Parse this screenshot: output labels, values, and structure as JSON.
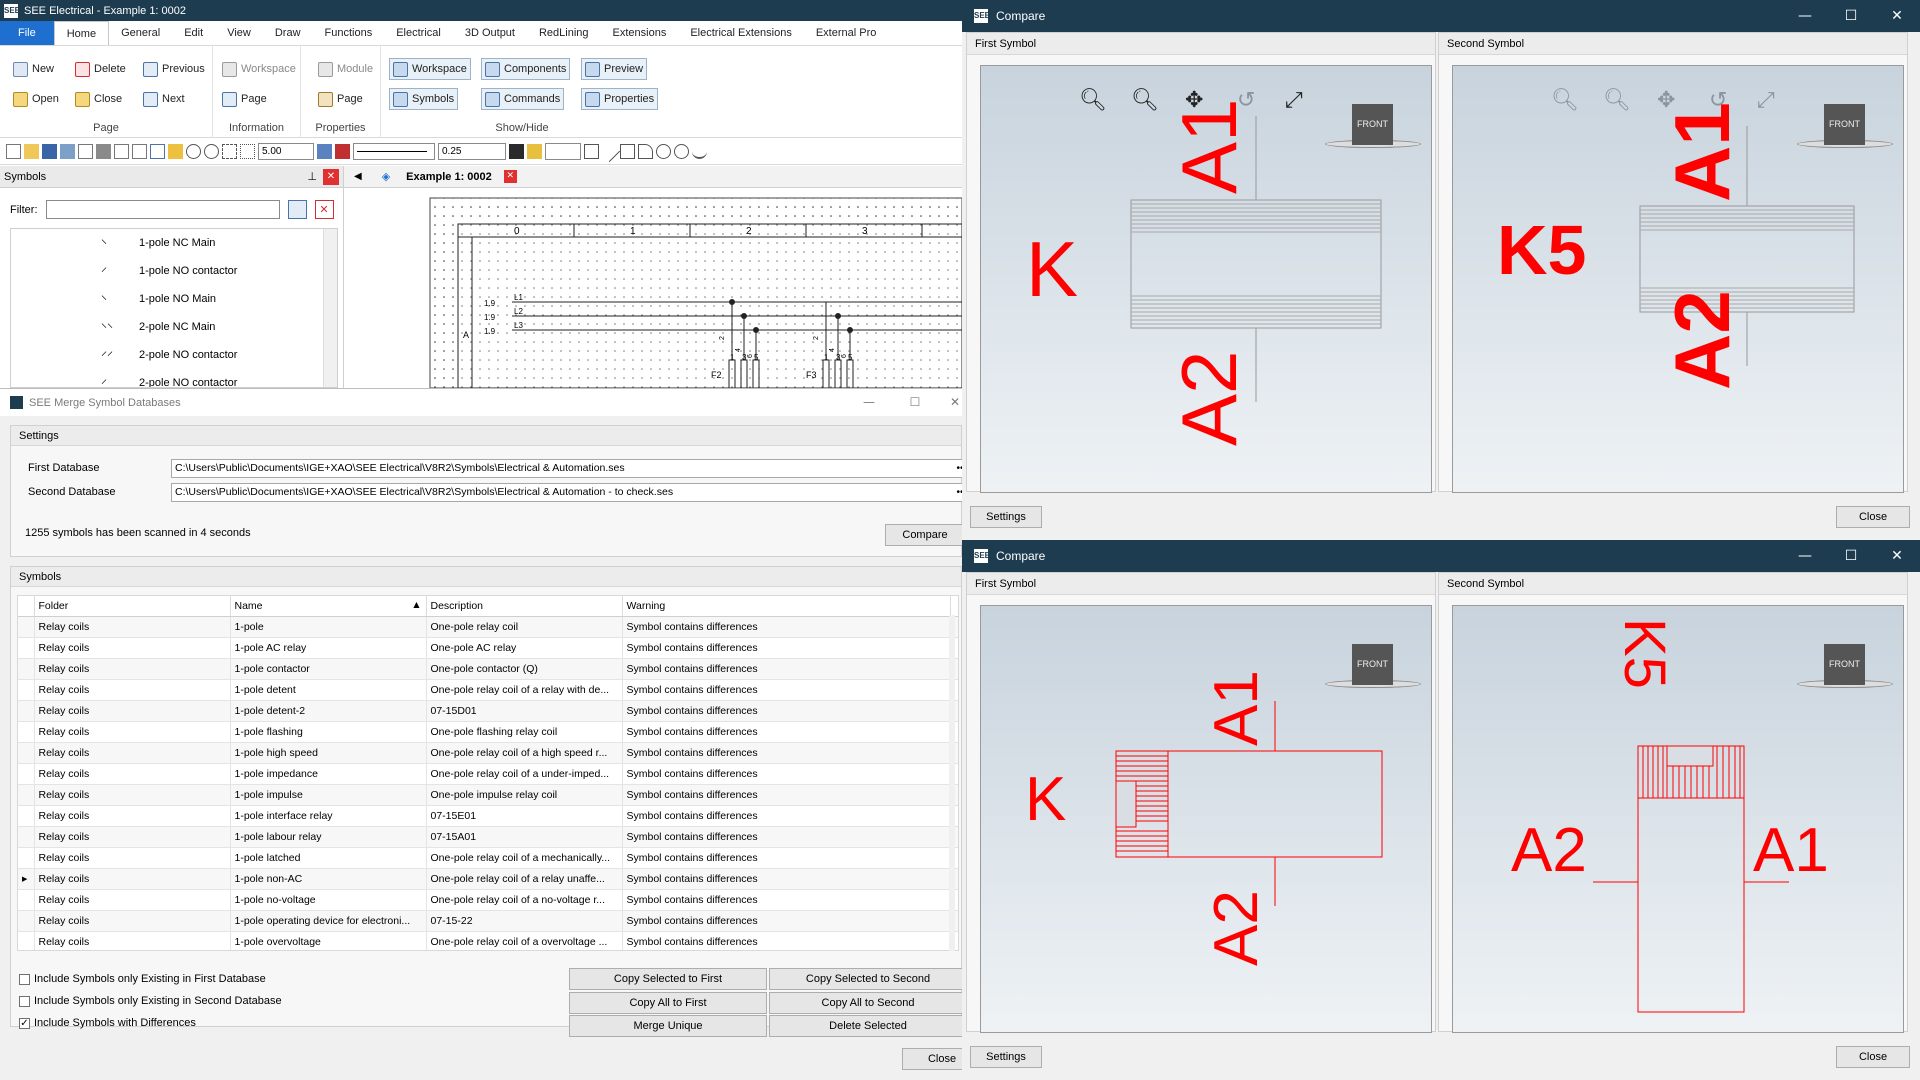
{
  "app": {
    "title": "SEE Electrical - Example 1: 0002",
    "logo": "SEE",
    "menu": [
      "File",
      "Home",
      "General",
      "Edit",
      "View",
      "Draw",
      "Functions",
      "Electrical",
      "3D Output",
      "RedLining",
      "Extensions",
      "Electrical Extensions",
      "External Pro"
    ],
    "ribbon": {
      "page": {
        "label": "Page",
        "new": "New",
        "delete": "Delete",
        "previous": "Previous",
        "open": "Open",
        "close": "Close",
        "next": "Next"
      },
      "information": {
        "label": "Information",
        "workspace": "Workspace",
        "page": "Page"
      },
      "properties": {
        "label": "Properties",
        "module": "Module",
        "page": "Page"
      },
      "showhide": {
        "label": "Show/Hide",
        "workspace": "Workspace",
        "components": "Components",
        "preview": "Preview",
        "symbols": "Symbols",
        "commands": "Commands",
        "properties": "Properties"
      }
    },
    "toolbar": {
      "grid": "5.00",
      "line_width": "0.25"
    },
    "symbols_panel": {
      "title": "Symbols",
      "filter_label": "Filter:",
      "filter_value": "",
      "items": [
        {
          "label": "1-pole NC Main",
          "glyph": "⸌"
        },
        {
          "label": "1-pole NO contactor",
          "glyph": "⸍"
        },
        {
          "label": "1-pole NO Main",
          "glyph": "⸌"
        },
        {
          "label": "2-pole NC Main",
          "glyph": "⸌⸌"
        },
        {
          "label": "2-pole NO contactor",
          "glyph": "⸍⸍"
        },
        {
          "label": "2-pole NO contactor",
          "glyph": "⸍"
        }
      ]
    },
    "drawing": {
      "tab": "Example 1: 0002",
      "columns": [
        "0",
        "1",
        "2",
        "3"
      ],
      "row_label": "A",
      "wires": [
        {
          "ref": "1.9",
          "name": "L1"
        },
        {
          "ref": "1.9",
          "name": "L2"
        },
        {
          "ref": "1.9",
          "name": "L3"
        }
      ],
      "fuses": [
        "F2",
        "F3"
      ],
      "terminals": [
        "1",
        "3",
        "5"
      ],
      "contacts": [
        "2",
        "4",
        "6"
      ]
    }
  },
  "merge_dialog": {
    "title": "SEE Merge Symbol Databases",
    "settings_label": "Settings",
    "first_db_label": "First Database",
    "first_db_value": "C:\\Users\\Public\\Documents\\IGE+XAO\\SEE Electrical\\V8R2\\Symbols\\Electrical & Automation.ses",
    "second_db_label": "Second Database",
    "second_db_value": "C:\\Users\\Public\\Documents\\IGE+XAO\\SEE Electrical\\V8R2\\Symbols\\Electrical & Automation - to check.ses",
    "browse": "•••",
    "scan_status": "1255 symbols has been scanned in 4 seconds",
    "compare_button": "Compare",
    "symbols_label": "Symbols",
    "columns": [
      "Folder",
      "Name",
      "Description",
      "Warning"
    ],
    "rows": [
      [
        "Relay coils",
        "1-pole",
        "One-pole relay coil",
        "Symbol contains differences"
      ],
      [
        "Relay coils",
        "1-pole AC relay",
        "One-pole AC relay",
        "Symbol contains differences"
      ],
      [
        "Relay coils",
        "1-pole contactor",
        "One-pole contactor (Q)",
        "Symbol contains differences"
      ],
      [
        "Relay coils",
        "1-pole detent",
        "One-pole relay coil of a relay with de...",
        "Symbol contains differences"
      ],
      [
        "Relay coils",
        "1-pole detent-2",
        "07-15D01",
        "Symbol contains differences"
      ],
      [
        "Relay coils",
        "1-pole flashing",
        "One-pole flashing relay coil",
        "Symbol contains differences"
      ],
      [
        "Relay coils",
        "1-pole high speed",
        "One-pole relay coil of a high speed r...",
        "Symbol contains differences"
      ],
      [
        "Relay coils",
        "1-pole impedance",
        "One-pole relay coil of a under-imped...",
        "Symbol contains differences"
      ],
      [
        "Relay coils",
        "1-pole impulse",
        "One-pole impulse relay coil",
        "Symbol contains differences"
      ],
      [
        "Relay coils",
        "1-pole interface relay",
        "07-15E01",
        "Symbol contains differences"
      ],
      [
        "Relay coils",
        "1-pole labour relay",
        "07-15A01",
        "Symbol contains differences"
      ],
      [
        "Relay coils",
        "1-pole latched",
        "One-pole relay coil of a mechanically...",
        "Symbol contains differences"
      ],
      [
        "Relay coils",
        "1-pole non-AC",
        "One-pole relay coil of a relay unaffe...",
        "Symbol contains differences"
      ],
      [
        "Relay coils",
        "1-pole no-voltage",
        "One-pole relay coil of a no-voltage r...",
        "Symbol contains differences"
      ],
      [
        "Relay coils",
        "1-pole operating device for electroni...",
        "07-15-22",
        "Symbol contains differences"
      ],
      [
        "Relay coils",
        "1-pole overvoltage",
        "One-pole relay coil of a overvoltage ...",
        "Symbol contains differences"
      ]
    ],
    "selected_row": 12,
    "checkboxes": [
      {
        "label": "Include Symbols only Existing in First Database",
        "checked": false
      },
      {
        "label": "Include Symbols only Existing in Second Database",
        "checked": false
      },
      {
        "label": "Include Symbols with Differences",
        "checked": true
      }
    ],
    "actions": {
      "copy_selected_first": "Copy Selected to First",
      "copy_selected_second": "Copy Selected to Second",
      "copy_all_first": "Copy All to First",
      "copy_all_second": "Copy All to Second",
      "merge_unique": "Merge Unique",
      "delete_selected": "Delete Selected"
    },
    "close": "Close"
  },
  "compare_top": {
    "title": "Compare",
    "first_label": "First Symbol",
    "second_label": "Second Symbol",
    "front": "FRONT",
    "settings": "Settings",
    "close": "Close",
    "first_texts": {
      "k": "K",
      "a1": "A1",
      "a2": "A2"
    },
    "second_texts": {
      "k": "K5",
      "a1": "A1",
      "a2": "A2"
    }
  },
  "compare_bottom": {
    "title": "Compare",
    "first_label": "First Symbol",
    "second_label": "Second Symbol",
    "front": "FRONT",
    "settings": "Settings",
    "close": "Close",
    "first_texts": {
      "k": "K",
      "a1": "A1",
      "a2": "A2"
    },
    "second_texts": {
      "k": "K5",
      "a1": "A1",
      "a2": "A2"
    }
  },
  "colors": {
    "titlebar": "#1d3c4f",
    "accent": "#1f6fd0",
    "symbol_red": "#ff0000"
  }
}
